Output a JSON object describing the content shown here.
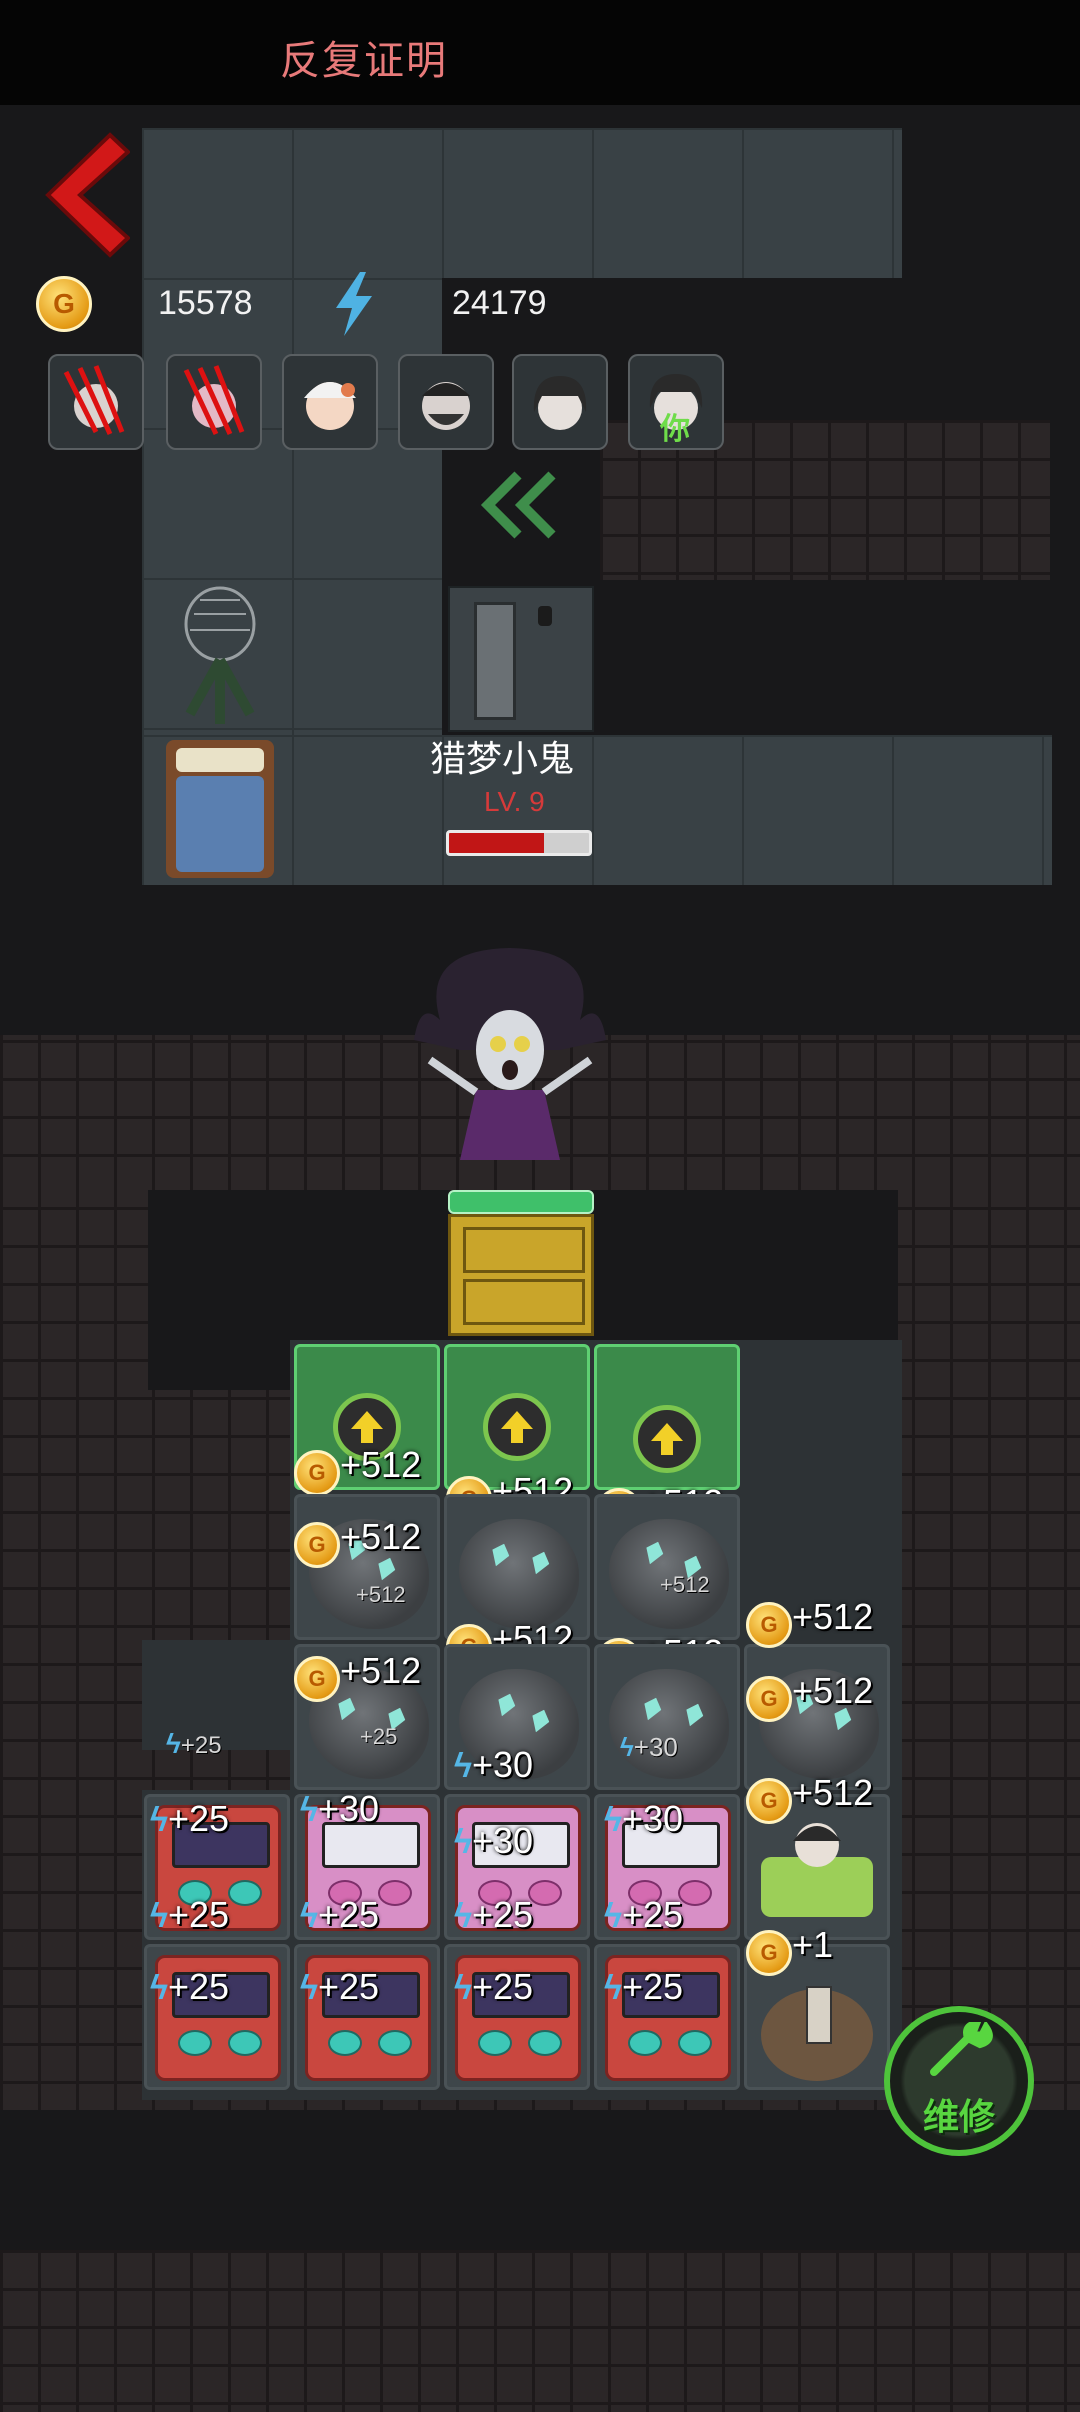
{
  "header": {
    "title": "反复证明"
  },
  "resources": {
    "coins": "15578",
    "energy": "24179",
    "coin_symbol": "G"
  },
  "characters": [
    {
      "name": "clawed-character-1"
    },
    {
      "name": "clawed-character-2"
    },
    {
      "name": "granny-character"
    },
    {
      "name": "bearded-man-character"
    },
    {
      "name": "dark-hair-girl-character"
    },
    {
      "name": "you-character",
      "label": "你"
    }
  ],
  "enemy": {
    "name": "猎梦小鬼",
    "level": "LV. 9",
    "hp_fraction": 0.68
  },
  "upgrade_row": [
    {
      "gain": "+512"
    },
    {
      "gain": "+512"
    },
    {
      "gain": "+512"
    }
  ],
  "mine_rows": [
    {
      "cells": [
        {
          "gain": "+512",
          "sub": "+512"
        },
        {
          "gain": "+512",
          "sub": ""
        },
        {
          "gain": "+512",
          "sub": "+512"
        }
      ]
    },
    {
      "cells": [
        {
          "gain": "+512",
          "sub": "+25"
        },
        {
          "gain": "+512",
          "sub": "+30"
        },
        {
          "gain": "+512",
          "sub": "+30"
        },
        {
          "gain": "+512",
          "sub": ""
        }
      ]
    }
  ],
  "side_gains": {
    "top_right": "+512",
    "left_small": "+25",
    "bed_gain": "+512",
    "bag_gain": "+1"
  },
  "arcade_rows": [
    {
      "cells": [
        {
          "top": "+25",
          "bottom": "+25"
        },
        {
          "top": "+30",
          "bottom": "+25"
        },
        {
          "top": "+30",
          "bottom": "+25"
        },
        {
          "top": "+30",
          "bottom": "+25"
        }
      ]
    },
    {
      "cells": [
        {
          "top": "+25"
        },
        {
          "top": "+25"
        },
        {
          "top": "+25"
        },
        {
          "top": "+25"
        }
      ]
    }
  ],
  "repair": {
    "label": "维修"
  },
  "colors": {
    "title": "#e87a7a",
    "enemy_level": "#d63a3a",
    "hp": "#c11616",
    "repair_green": "#4ec43b",
    "upgrade_green": "#3b8a4a"
  }
}
